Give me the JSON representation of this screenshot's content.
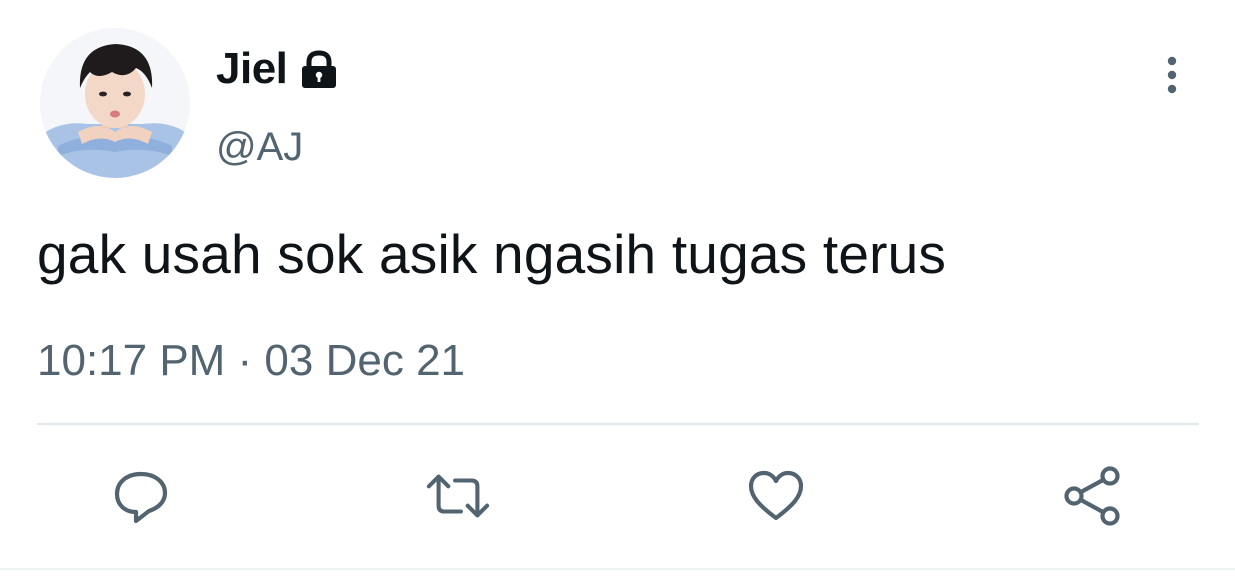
{
  "tweet": {
    "display_name": "Jiel",
    "handle": "@AJ",
    "text": "gak usah sok asik ngasih tugas terus",
    "timestamp": "10:17 PM · 03 Dec 21",
    "protected": true
  },
  "icons": {
    "lock": "lock-icon",
    "more": "more-vertical-icon",
    "reply": "reply-icon",
    "retweet": "retweet-icon",
    "like": "heart-icon",
    "share": "share-icon"
  },
  "colors": {
    "text_primary": "#0f1419",
    "text_secondary": "#536471",
    "icon": "#536471",
    "divider": "#e1e8ed",
    "background": "#ffffff"
  }
}
